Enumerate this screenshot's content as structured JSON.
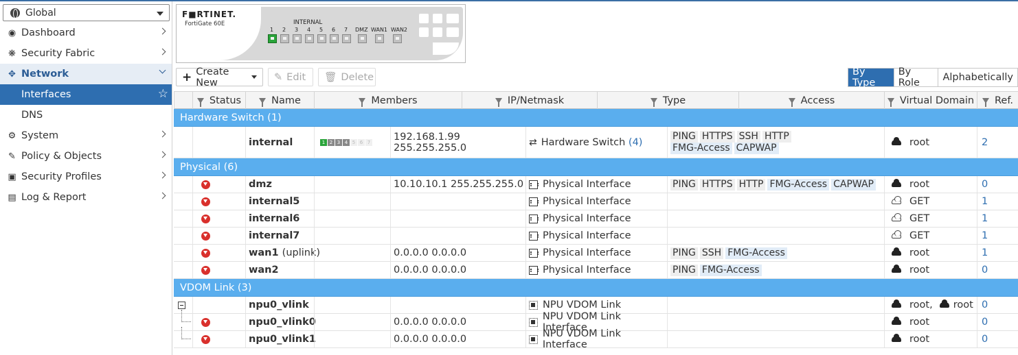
{
  "vdom": {
    "selected": "Global"
  },
  "nav": {
    "items": [
      {
        "id": "dashboard",
        "label": "Dashboard",
        "icon": "dashboard-icon"
      },
      {
        "id": "security-fabric",
        "label": "Security Fabric",
        "icon": "fabric-icon"
      },
      {
        "id": "network",
        "label": "Network",
        "icon": "network-icon",
        "open": true
      }
    ],
    "network_sub": [
      {
        "label": "Interfaces",
        "active": true
      },
      {
        "label": "DNS"
      }
    ],
    "after": [
      {
        "id": "system",
        "label": "System",
        "icon": "gear-icon"
      },
      {
        "id": "policy-objects",
        "label": "Policy & Objects",
        "icon": "policy-icon"
      },
      {
        "id": "security-profiles",
        "label": "Security Profiles",
        "icon": "lock-icon"
      },
      {
        "id": "log-report",
        "label": "Log & Report",
        "icon": "chart-icon"
      }
    ]
  },
  "device": {
    "brand": "F■RTINET.",
    "model": "FortiGate 60E",
    "internal_label": "INTERNAL",
    "port_labels": [
      "1",
      "2",
      "3",
      "4",
      "5",
      "6",
      "7",
      "DMZ",
      "WAN1",
      "WAN2"
    ]
  },
  "toolbar": {
    "create_new": "Create New",
    "edit": "Edit",
    "delete": "Delete"
  },
  "view_toggle": {
    "by_type": "By Type",
    "by_role": "By Role",
    "alphabetically": "Alphabetically"
  },
  "columns": [
    "Status",
    "Name",
    "Members",
    "IP/Netmask",
    "Type",
    "Access",
    "Virtual Domain",
    "Ref."
  ],
  "groups": {
    "hw": "Hardware Switch (1)",
    "phys": "Physical (6)",
    "vdom": "VDOM Link (3)"
  },
  "rows": {
    "internal": {
      "name": "internal",
      "ip": "192.168.1.99 255.255.255.0",
      "type": "Hardware Switch",
      "type_count": "(4)",
      "access": [
        "PING",
        "HTTPS",
        "SSH",
        "HTTP",
        "FMG-Access",
        "CAPWAP"
      ],
      "vdom": "root",
      "ref": "2",
      "members": [
        "1",
        "2",
        "3",
        "4",
        "5",
        "6",
        "7"
      ]
    },
    "dmz": {
      "name": "dmz",
      "ip": "10.10.10.1 255.255.255.0",
      "type": "Physical Interface",
      "access": [
        "PING",
        "HTTPS",
        "HTTP",
        "FMG-Access",
        "CAPWAP"
      ],
      "vdom": "root",
      "ref": "0"
    },
    "internal5": {
      "name": "internal5",
      "ip": "",
      "type": "Physical Interface",
      "vdom": "GET",
      "ref": "1"
    },
    "internal6": {
      "name": "internal6",
      "ip": "",
      "type": "Physical Interface",
      "vdom": "GET",
      "ref": "1"
    },
    "internal7": {
      "name": "internal7",
      "ip": "",
      "type": "Physical Interface",
      "vdom": "GET",
      "ref": "1"
    },
    "wan1": {
      "name": "wan1",
      "role": "(uplink)",
      "ip": "0.0.0.0 0.0.0.0",
      "type": "Physical Interface",
      "access": [
        "PING",
        "SSH",
        "FMG-Access"
      ],
      "vdom": "root",
      "ref": "1"
    },
    "wan2": {
      "name": "wan2",
      "ip": "0.0.0.0 0.0.0.0",
      "type": "Physical Interface",
      "access": [
        "PING",
        "FMG-Access"
      ],
      "vdom": "root",
      "ref": "0"
    },
    "npu0_vlink": {
      "name": "npu0_vlink",
      "ip": "",
      "type": "NPU VDOM Link",
      "vdom": "root,",
      "vdom2": "root",
      "ref": "0"
    },
    "npu0_vlink0": {
      "name": "npu0_vlink0",
      "ip": "0.0.0.0 0.0.0.0",
      "type": "NPU VDOM Link Interface",
      "vdom": "root",
      "ref": "0"
    },
    "npu0_vlink1": {
      "name": "npu0_vlink1",
      "ip": "0.0.0.0 0.0.0.0",
      "type": "NPU VDOM Link Interface",
      "vdom": "root",
      "ref": "0"
    }
  }
}
